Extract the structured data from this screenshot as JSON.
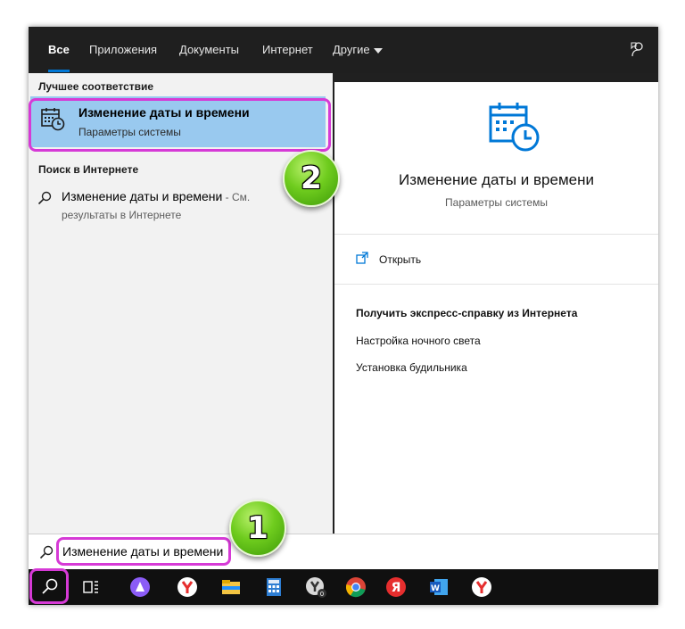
{
  "tabs": [
    {
      "label": "Все",
      "active": true
    },
    {
      "label": "Приложения"
    },
    {
      "label": "Документы"
    },
    {
      "label": "Интернет"
    },
    {
      "label": "Другие"
    }
  ],
  "left": {
    "best_match_heading": "Лучшее соответствие",
    "best_match": {
      "title": "Изменение даты и времени",
      "subtitle": "Параметры системы",
      "icon": "calendar-clock-icon"
    },
    "web_heading": "Поиск в Интернете",
    "web_result": {
      "title": "Изменение даты и времени",
      "suffix": " - См.",
      "line2": "результаты в Интернете"
    }
  },
  "right": {
    "title": "Изменение даты и времени",
    "subtitle": "Параметры системы",
    "open_label": "Открыть",
    "help_heading": "Получить экспресс-справку из Интернета",
    "help_links": [
      "Настройка ночного света",
      "Установка будильника"
    ]
  },
  "search": {
    "value": "Изменение даты и времени"
  },
  "taskbar": {
    "items": [
      "search-icon",
      "task-view-icon",
      "alice-icon",
      "yandex-browser-icon",
      "file-explorer-icon",
      "calculator-icon",
      "yandex-alt-icon",
      "chrome-icon",
      "yandex-app-icon",
      "word-icon",
      "yandex-browser-2-icon"
    ]
  },
  "badges": {
    "one": "1",
    "two": "2"
  },
  "colors": {
    "accent": "#0078d7",
    "selection": "#99c9ef",
    "highlight": "#d63ad6",
    "badge": "#6fcc1e"
  }
}
